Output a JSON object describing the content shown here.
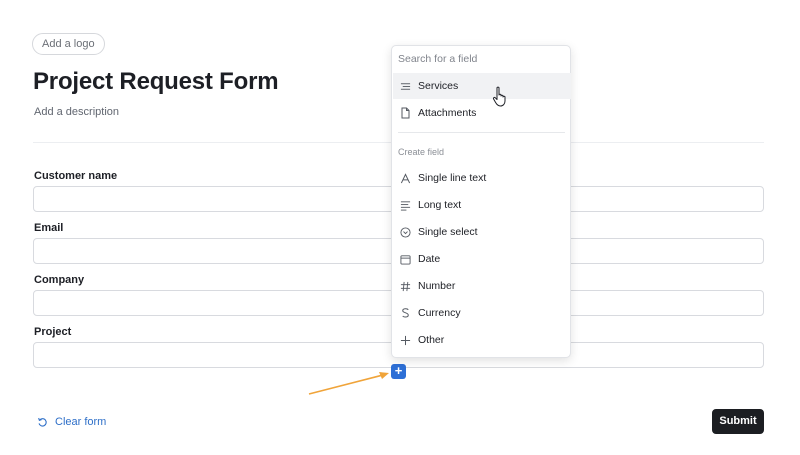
{
  "form": {
    "add_logo_label": "Add a logo",
    "title": "Project Request Form",
    "description": "Add a description",
    "fields": [
      {
        "label": "Customer name",
        "value": ""
      },
      {
        "label": "Email",
        "value": ""
      },
      {
        "label": "Company",
        "value": ""
      },
      {
        "label": "Project",
        "value": ""
      }
    ],
    "add_field_symbol": "+",
    "clear_label": "Clear form",
    "submit_label": "Submit"
  },
  "dropdown": {
    "search_placeholder": "Search for a field",
    "existing_fields": [
      {
        "label": "Services",
        "icon": "list-icon"
      },
      {
        "label": "Attachments",
        "icon": "file-icon"
      }
    ],
    "create_section_label": "Create field",
    "create_types": [
      {
        "label": "Single line text",
        "icon": "text-a-icon"
      },
      {
        "label": "Long text",
        "icon": "long-text-icon"
      },
      {
        "label": "Single select",
        "icon": "chevron-circle-icon"
      },
      {
        "label": "Date",
        "icon": "calendar-icon"
      },
      {
        "label": "Number",
        "icon": "hash-icon"
      },
      {
        "label": "Currency",
        "icon": "dollar-icon"
      },
      {
        "label": "Other",
        "icon": "plus-icon"
      }
    ]
  },
  "colors": {
    "accent": "#2d6fd6",
    "link": "#2e6fc8",
    "submit_bg": "#1c1e22",
    "annotation_arrow": "#f0a43a"
  }
}
